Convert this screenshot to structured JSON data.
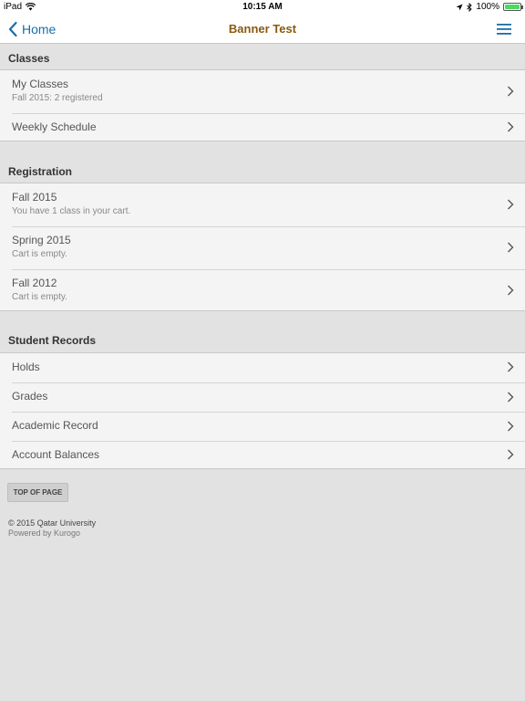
{
  "status_bar": {
    "device": "iPad",
    "time": "10:15 AM",
    "battery": "100%"
  },
  "nav": {
    "back_label": "Home",
    "title": "Banner Test"
  },
  "sections": {
    "classes": {
      "header": "Classes",
      "items": [
        {
          "title": "My Classes",
          "subtitle": "Fall 2015: 2 registered"
        },
        {
          "title": "Weekly Schedule"
        }
      ]
    },
    "registration": {
      "header": "Registration",
      "items": [
        {
          "title": "Fall 2015",
          "subtitle": "You have 1 class in your cart."
        },
        {
          "title": "Spring 2015",
          "subtitle": "Cart is empty."
        },
        {
          "title": "Fall 2012",
          "subtitle": "Cart is empty."
        }
      ]
    },
    "student_records": {
      "header": "Student Records",
      "items": [
        {
          "title": "Holds"
        },
        {
          "title": "Grades"
        },
        {
          "title": "Academic Record"
        },
        {
          "title": "Account Balances"
        }
      ]
    }
  },
  "top_button": "TOP OF PAGE",
  "footer": {
    "copyright": "© 2015 Qatar University",
    "powered_by": "Powered by Kurogo"
  },
  "colors": {
    "accent": "#1a6ea8",
    "title": "#8a5a10",
    "background": "#e2e2e2",
    "row_background": "#f4f4f4",
    "battery": "#4cd964"
  }
}
